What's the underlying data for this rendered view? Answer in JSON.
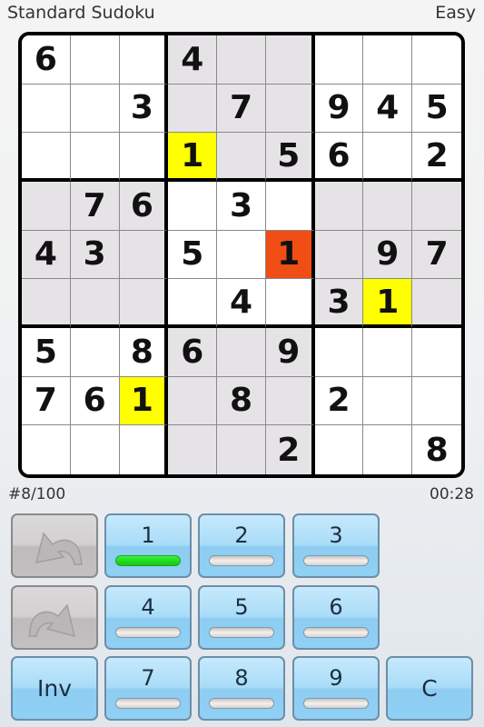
{
  "header": {
    "title": "Standard Sudoku",
    "difficulty": "Easy"
  },
  "board": {
    "rows": [
      [
        "6",
        "",
        "",
        "4",
        "",
        "",
        "",
        "",
        ""
      ],
      [
        "",
        "",
        "3",
        "",
        "7",
        "",
        "9",
        "4",
        "5"
      ],
      [
        "",
        "",
        "",
        "1",
        "",
        "5",
        "6",
        "",
        "2"
      ],
      [
        "",
        "7",
        "6",
        "",
        "3",
        "",
        "",
        "",
        ""
      ],
      [
        "4",
        "3",
        "",
        "5",
        "",
        "1",
        "",
        "9",
        "7"
      ],
      [
        "",
        "",
        "",
        "",
        "4",
        "",
        "3",
        "1",
        ""
      ],
      [
        "5",
        "",
        "8",
        "6",
        "",
        "9",
        "",
        "",
        ""
      ],
      [
        "7",
        "6",
        "1",
        "",
        "8",
        "",
        "2",
        "",
        ""
      ],
      [
        "",
        "",
        "",
        "",
        "",
        "2",
        "",
        "",
        "8"
      ]
    ],
    "highlights": {
      "yellow": [
        [
          2,
          3
        ],
        [
          5,
          7
        ],
        [
          7,
          2
        ]
      ],
      "orange": [
        [
          4,
          5
        ]
      ]
    },
    "colors": {
      "shade": "#e6e3e6",
      "yellow": "#ffff00",
      "orange": "#f04e14"
    }
  },
  "status": {
    "puzzle_number": "#8/100",
    "timer": "00:28"
  },
  "controls": {
    "undo_icon": "undo-arrow-icon",
    "redo_icon": "redo-arrow-icon",
    "numbers": [
      "1",
      "2",
      "3",
      "4",
      "5",
      "6",
      "7",
      "8",
      "9"
    ],
    "active_number": "1",
    "inv_label": "Inv",
    "clear_label": "C",
    "active_color": "#22dd22"
  }
}
